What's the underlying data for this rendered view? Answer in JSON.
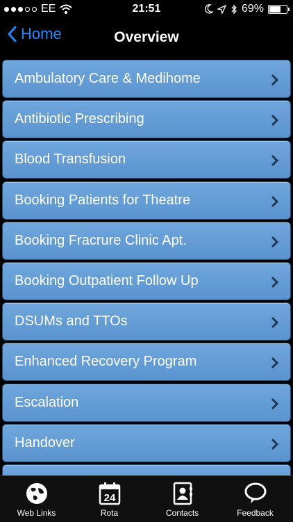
{
  "status_bar": {
    "carrier": "EE",
    "time": "21:51",
    "battery": "69%",
    "battery_level": 0.69
  },
  "nav": {
    "back_label": "Home",
    "title": "Overview"
  },
  "items": [
    "Ambulatory Care & Medihome",
    "Antibiotic Prescribing",
    "Blood Transfusion",
    "Booking Patients for Theatre",
    "Booking Fracrure Clinic Apt.",
    "Booking Outpatient Follow Up",
    "DSUMs and TTOs",
    "Enhanced Recovery Program",
    "Escalation",
    "Handover"
  ],
  "tabs": [
    {
      "label": "Web Links",
      "icon": "globe-icon"
    },
    {
      "label": "Rota",
      "icon": "calendar-icon",
      "calendar_day": "24"
    },
    {
      "label": "Contacts",
      "icon": "contacts-book-icon"
    },
    {
      "label": "Feedback",
      "icon": "speech-bubble-icon"
    }
  ],
  "colors": {
    "row": "#5f9ad4",
    "back": "#1e88ff"
  }
}
